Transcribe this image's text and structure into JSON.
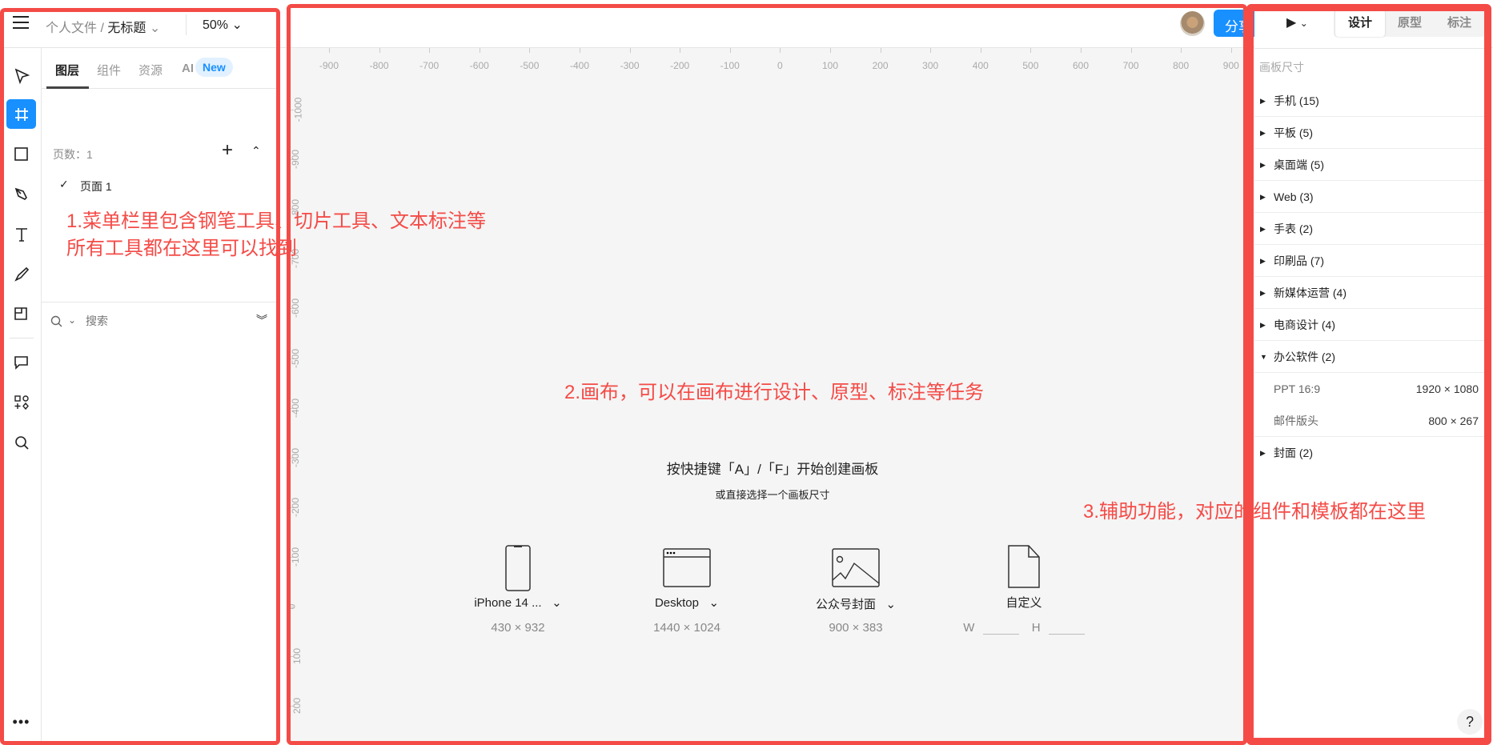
{
  "topbar": {
    "crumb_parent": "个人文件 /",
    "crumb_file": "无标题",
    "zoom": "50%",
    "share_label": "分享"
  },
  "layers_panel": {
    "tabs": [
      "图层",
      "组件",
      "资源",
      "AI"
    ],
    "new_badge": "New",
    "pages_label": "页数：1",
    "page_item": "页面 1",
    "search_placeholder": "搜索"
  },
  "canvas": {
    "hint_title": "按快捷键「A」/「F」开始创建画板",
    "hint_sub": "或直接选择一个画板尺寸",
    "presets": [
      {
        "name": "iPhone 14 ...",
        "size": "430 × 932",
        "icon": "phone-icon"
      },
      {
        "name": "Desktop",
        "size": "1440 × 1024",
        "icon": "browser-window-icon"
      },
      {
        "name": "公众号封面",
        "size": "900 × 383",
        "icon": "image-icon"
      },
      {
        "name": "自定义",
        "w_label": "W",
        "h_label": "H",
        "icon": "file-icon"
      }
    ],
    "ruler_x": [
      "-900",
      "-800",
      "-700",
      "-600",
      "-500",
      "-400",
      "-300",
      "-200",
      "-100",
      "0",
      "100",
      "200",
      "300",
      "400",
      "500",
      "600",
      "700",
      "800",
      "900"
    ],
    "ruler_y": [
      "-1000",
      "-900",
      "-800",
      "-700",
      "-600",
      "-500",
      "-400",
      "-300",
      "-200",
      "-100",
      "0",
      "100",
      "200"
    ]
  },
  "right_panel": {
    "tabs": [
      "设计",
      "原型",
      "标注"
    ],
    "section_title": "画板尺寸",
    "categories": [
      "手机 (15)",
      "平板 (5)",
      "桌面端 (5)",
      "Web (3)",
      "手表 (2)",
      "印刷品 (7)",
      "新媒体运营 (4)",
      "电商设计 (4)",
      "办公软件 (2)"
    ],
    "expanded_items": [
      {
        "name": "PPT 16:9",
        "size": "1920 × 1080"
      },
      {
        "name": "邮件版头",
        "size": "800 × 267"
      }
    ],
    "last_category": "封面 (2)",
    "help": "?"
  },
  "annotations": {
    "a1_line1": "1.菜单栏里包含钢笔工具、切片工具、文本标注等",
    "a1_line2": "所有工具都在这里可以找到",
    "a2": "2.画布，可以在画布进行设计、原型、标注等任务",
    "a3": "3.辅助功能，对应的组件和模板都在这里"
  },
  "colors": {
    "accent": "#1890ff",
    "annotation": "#f44b47"
  }
}
